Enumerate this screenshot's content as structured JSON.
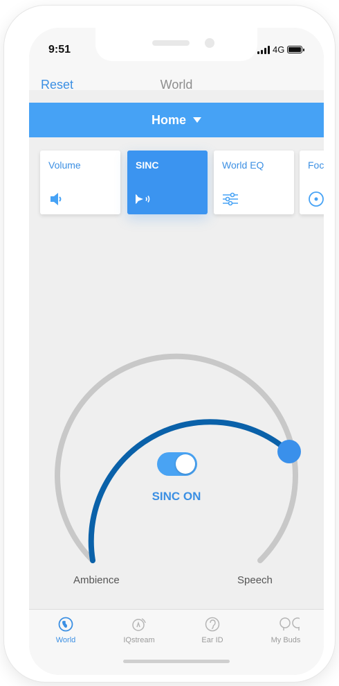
{
  "status": {
    "time": "9:51",
    "network": "4G"
  },
  "nav": {
    "reset_label": "Reset",
    "title": "World"
  },
  "preset": {
    "label": "Home"
  },
  "cards": [
    {
      "label": "Volume",
      "icon": "speaker-icon",
      "active": false
    },
    {
      "label": "SINC",
      "icon": "sinc-icon",
      "active": true
    },
    {
      "label": "World EQ",
      "icon": "equalizer-icon",
      "active": false
    },
    {
      "label": "Foc",
      "icon": "focus-icon",
      "active": false
    }
  ],
  "sinc": {
    "toggle_on": true,
    "status_label": "SINC ON",
    "left_label": "Ambience",
    "right_label": "Speech",
    "level": 0.68
  },
  "colors": {
    "accent": "#3b8fe3",
    "banner": "#46a2f5",
    "dial_active": "#0a61a9",
    "dial_inactive": "#c8c8c8"
  },
  "tabs": [
    {
      "label": "World",
      "icon": "globe-icon",
      "active": true
    },
    {
      "label": "IQstream",
      "icon": "iqstream-icon",
      "active": false
    },
    {
      "label": "Ear ID",
      "icon": "ear-icon",
      "active": false
    },
    {
      "label": "My Buds",
      "icon": "earbuds-icon",
      "active": false
    }
  ]
}
